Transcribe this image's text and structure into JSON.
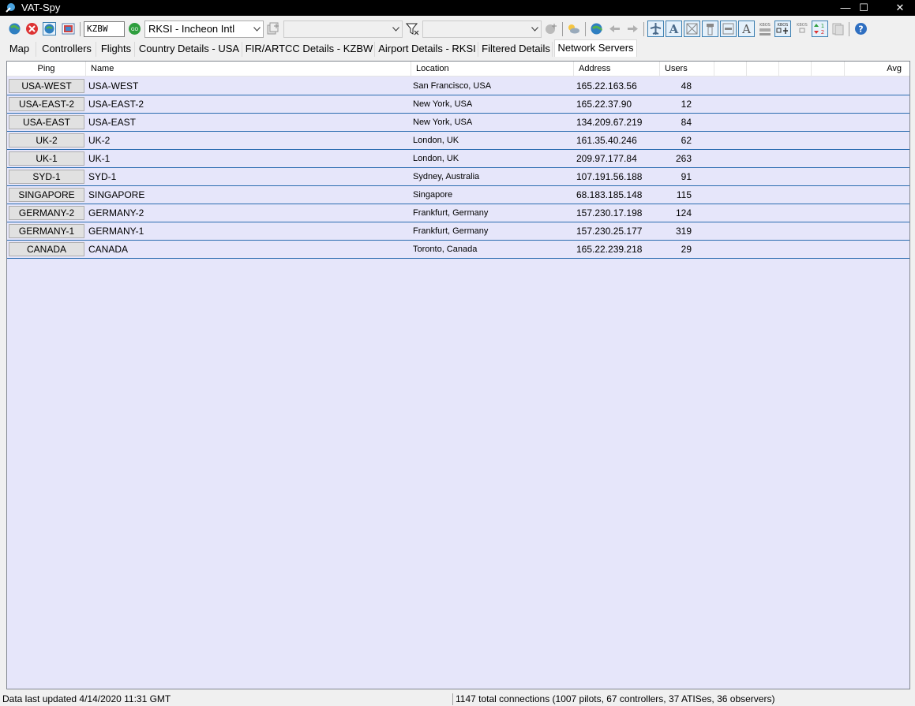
{
  "window": {
    "title": "VAT-Spy",
    "controls": {
      "minimize": "—",
      "maximize": "☐",
      "close": "✕"
    }
  },
  "toolbar": {
    "icao_input": "KZBW",
    "airport_select": "RKSI - Incheon Intl",
    "filter_select_1": "",
    "filter_select_2": "",
    "icons": [
      "refresh-globe-icon",
      "disconnect-icon",
      "connect-icon",
      "settings-icon",
      "go-icon",
      "add-icon",
      "filter-icon",
      "zoom-icon",
      "weather-icon",
      "globe-icon",
      "back-arrow-icon",
      "forward-arrow-icon",
      "aircraft-icon",
      "text-a-icon",
      "airport-icon",
      "tower-icon",
      "runway-icon",
      "label-a-icon",
      "kbos-label-icon",
      "kbos-aircraft-icon",
      "kbos-small-icon",
      "sort-icon",
      "copy-icon",
      "help-icon"
    ]
  },
  "tabs": [
    {
      "label": "Map"
    },
    {
      "label": "Controllers"
    },
    {
      "label": "Flights"
    },
    {
      "label": "Country Details - USA"
    },
    {
      "label": "FIR/ARTCC Details - KZBW"
    },
    {
      "label": "Airport Details - RKSI"
    },
    {
      "label": "Filtered Details"
    },
    {
      "label": "Network Servers"
    }
  ],
  "active_tab": "Network Servers",
  "grid": {
    "columns": {
      "ping": "Ping",
      "name": "Name",
      "location": "Location",
      "address": "Address",
      "users": "Users",
      "avg": "Avg"
    },
    "rows": [
      {
        "ping": "USA-WEST",
        "name": "USA-WEST",
        "location": "San Francisco, USA",
        "address": "165.22.163.56",
        "users": "48"
      },
      {
        "ping": "USA-EAST-2",
        "name": "USA-EAST-2",
        "location": "New York, USA",
        "address": "165.22.37.90",
        "users": "12"
      },
      {
        "ping": "USA-EAST",
        "name": "USA-EAST",
        "location": "New York, USA",
        "address": "134.209.67.219",
        "users": "84"
      },
      {
        "ping": "UK-2",
        "name": "UK-2",
        "location": "London, UK",
        "address": "161.35.40.246",
        "users": "62"
      },
      {
        "ping": "UK-1",
        "name": "UK-1",
        "location": "London, UK",
        "address": "209.97.177.84",
        "users": "263"
      },
      {
        "ping": "SYD-1",
        "name": "SYD-1",
        "location": "Sydney, Australia",
        "address": "107.191.56.188",
        "users": "91"
      },
      {
        "ping": "SINGAPORE",
        "name": "SINGAPORE",
        "location": "Singapore",
        "address": "68.183.185.148",
        "users": "115"
      },
      {
        "ping": "GERMANY-2",
        "name": "GERMANY-2",
        "location": "Frankfurt, Germany",
        "address": "157.230.17.198",
        "users": "124"
      },
      {
        "ping": "GERMANY-1",
        "name": "GERMANY-1",
        "location": "Frankfurt, Germany",
        "address": "157.230.25.177",
        "users": "319"
      },
      {
        "ping": "CANADA",
        "name": "CANADA",
        "location": "Toronto, Canada",
        "address": "165.22.239.218",
        "users": "29"
      }
    ]
  },
  "status": {
    "last_updated": "Data last updated 4/14/2020 11:31 GMT",
    "connections": "1147 total connections (1007 pilots, 67 controllers, 37 ATISes, 36 observers)"
  },
  "colors": {
    "grid_background": "#e6e6fa",
    "row_separator": "#2b6cb0",
    "titlebar": "#000000"
  }
}
